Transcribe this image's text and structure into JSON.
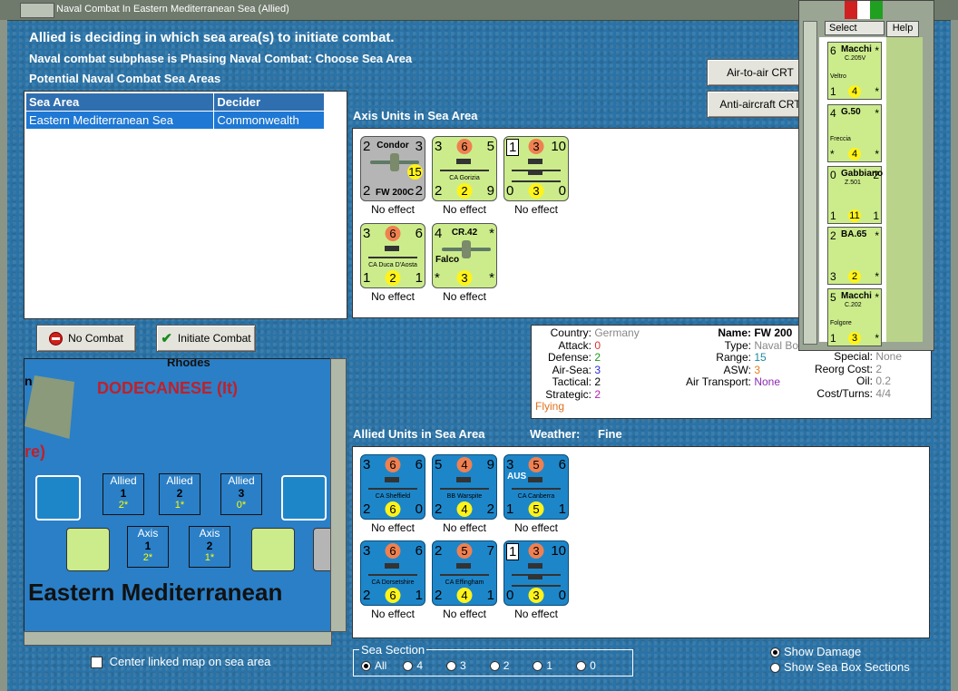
{
  "window": {
    "title": "Naval Combat In Eastern Mediterranean Sea (Allied)"
  },
  "status": {
    "line1": "Allied is deciding in which sea area(s) to initiate combat.",
    "line2": "Naval combat subphase is Phasing Naval Combat: Choose Sea Area",
    "line3": "Potential Naval Combat Sea Areas"
  },
  "sea_table": {
    "headers": [
      "Sea Area",
      "Decider"
    ],
    "rows": [
      [
        "Eastern Mediterranean Sea",
        "Commonwealth"
      ]
    ]
  },
  "buttons": {
    "air_to_air": "Air-to-air CRT",
    "anti_aircraft": "Anti-aircraft CRT",
    "no_combat": "No Combat",
    "initiate_combat": "Initiate Combat"
  },
  "axis_panel": {
    "label": "Axis Units in Sea Area",
    "units": [
      {
        "name": "Condor",
        "code": "FW 200C",
        "tl": "2",
        "tr": "3",
        "bl": "2",
        "bm": "",
        "br": "2",
        "circle": "15",
        "effect": "No effect"
      },
      {
        "name": "CA Gorizia",
        "code": "",
        "tl": "3",
        "tr": "5",
        "tm": "6",
        "bl": "2",
        "bm": "2",
        "br": "9",
        "effect": "No effect"
      },
      {
        "name": "",
        "code": "",
        "tl": "1",
        "tm": "3",
        "tr": "10",
        "bl": "0",
        "bm": "3",
        "br": "0",
        "effect": "No effect"
      },
      {
        "name": "CA Duca D'Aosta",
        "code": "",
        "tl": "3",
        "tm": "6",
        "tr": "6",
        "bl": "1",
        "bm": "2",
        "br": "1",
        "effect": "No effect"
      },
      {
        "name": "CR.42",
        "code": "Falco",
        "tl": "4",
        "tr": "*",
        "bl": "*",
        "bm": "3",
        "br": "*",
        "effect": "No effect"
      }
    ]
  },
  "details": {
    "country_label": "Country:",
    "country": "Germany",
    "attack_label": "Attack:",
    "attack": "0",
    "defense_label": "Defense:",
    "defense": "2",
    "airsea_label": "Air-Sea:",
    "airsea": "3",
    "tactical_label": "Tactical:",
    "tactical": "2",
    "strategic_label": "Strategic:",
    "strategic": "2",
    "flying": "Flying",
    "name_label": "Name:",
    "name": "FW 200",
    "type_label": "Type:",
    "type": "Naval Bo",
    "range_label": "Range:",
    "range": "15",
    "asw_label": "ASW:",
    "asw": "3",
    "airtransport_label": "Air Transport:",
    "airtransport": "None",
    "special_label": "Special:",
    "special": "None",
    "reorg_label": "Reorg Cost:",
    "reorg": "2",
    "oil_label": "Oil:",
    "oil": "0.2",
    "cost_label": "Cost/Turns:",
    "cost": "4/4"
  },
  "allied_panel": {
    "label": "Allied Units in Sea Area",
    "weather_label": "Weather:",
    "weather": "Fine",
    "units": [
      {
        "name": "CA Sheffield",
        "tl": "3",
        "tm": "6",
        "tr": "6",
        "bl": "2",
        "bm": "6",
        "br": "0",
        "effect": "No effect"
      },
      {
        "name": "BB Warspite",
        "tl": "5",
        "tm": "4",
        "tr": "9",
        "bl": "2",
        "bm": "4",
        "br": "2",
        "effect": "No effect"
      },
      {
        "name": "CA Canberra",
        "tl": "3",
        "tm": "5",
        "tr": "6",
        "bl": "1",
        "bm": "5",
        "br": "1",
        "effect": "No effect",
        "badge": "AUS"
      },
      {
        "name": "CA Dorsetshire",
        "tl": "3",
        "tm": "6",
        "tr": "6",
        "bl": "2",
        "bm": "6",
        "br": "1",
        "effect": "No effect"
      },
      {
        "name": "CA Effingham",
        "tl": "2",
        "tm": "5",
        "tr": "7",
        "bl": "2",
        "bm": "4",
        "br": "1",
        "effect": "No effect"
      },
      {
        "name": "",
        "tl": "1",
        "tm": "3",
        "tr": "10",
        "bl": "0",
        "bm": "3",
        "br": "0",
        "effect": "No effect"
      }
    ]
  },
  "map": {
    "rhodes": "Rhodes",
    "dodecanese": "DODECANESE (It)",
    "re_fragment": "re)",
    "n_fragment": "n",
    "sea_name": "Eastern Mediterranean",
    "boxes": [
      {
        "side": "Allied",
        "num": "1",
        "val": "2*"
      },
      {
        "side": "Allied",
        "num": "2",
        "val": "1*"
      },
      {
        "side": "Allied",
        "num": "3",
        "val": "0*"
      },
      {
        "side": "Axis",
        "num": "1",
        "val": "2*"
      },
      {
        "side": "Axis",
        "num": "2",
        "val": "1*"
      }
    ]
  },
  "center_linked": "Center linked map on sea area",
  "sea_section": {
    "label": "Sea Section",
    "options": [
      "All",
      "4",
      "3",
      "2",
      "1",
      "0"
    ],
    "selected": "All"
  },
  "display": {
    "show_damage": "Show Damage",
    "show_sea_box": "Show Sea Box Sections"
  },
  "side_panel": {
    "select_tab": "Select",
    "help_tab": "Help",
    "units": [
      {
        "name": "Macchi",
        "code": "C.205V",
        "sub": "Veltro",
        "tl": "6",
        "tr": "*",
        "bl": "1",
        "bm": "4",
        "br": "*"
      },
      {
        "name": "G.50",
        "code": "",
        "sub": "Freccia",
        "tl": "4",
        "tr": "*",
        "bl": "*",
        "bm": "4",
        "br": "*"
      },
      {
        "name": "Gabbiano",
        "code": "Z.501",
        "sub": "",
        "tl": "0",
        "tr": "2",
        "bl": "1",
        "bm": "11",
        "br": "1"
      },
      {
        "name": "BA.65",
        "code": "",
        "sub": "",
        "tl": "2",
        "tr": "*",
        "bl": "3",
        "bm": "2",
        "br": "*"
      },
      {
        "name": "Macchi",
        "code": "C.202",
        "sub": "Folgore",
        "tl": "5",
        "tr": "*",
        "bl": "1",
        "bm": "3",
        "br": "*"
      }
    ]
  }
}
